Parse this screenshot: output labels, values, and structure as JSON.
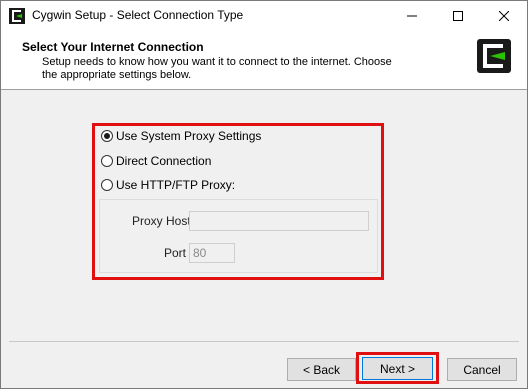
{
  "window": {
    "title": "Cygwin Setup - Select Connection Type",
    "controls": {
      "minimize": "minimize-icon",
      "maximize": "maximize-icon",
      "close": "close-icon"
    }
  },
  "header": {
    "title": "Select Your Internet Connection",
    "description": "Setup needs to know how you want it to connect to the internet.  Choose the appropriate settings below.",
    "logo": "cygwin-logo-icon"
  },
  "options": [
    {
      "label": "Use System Proxy Settings",
      "selected": true
    },
    {
      "label": "Direct Connection",
      "selected": false
    },
    {
      "label": "Use HTTP/FTP Proxy:",
      "selected": false
    }
  ],
  "proxy": {
    "host_label": "Proxy Host",
    "host_value": "",
    "port_label": "Port",
    "port_value": "80",
    "enabled": false
  },
  "buttons": {
    "back": "< Back",
    "next": "Next >",
    "cancel": "Cancel"
  },
  "colors": {
    "highlight": "#e01010",
    "focus_border": "#0078d7",
    "logo_green": "#2cc100"
  }
}
